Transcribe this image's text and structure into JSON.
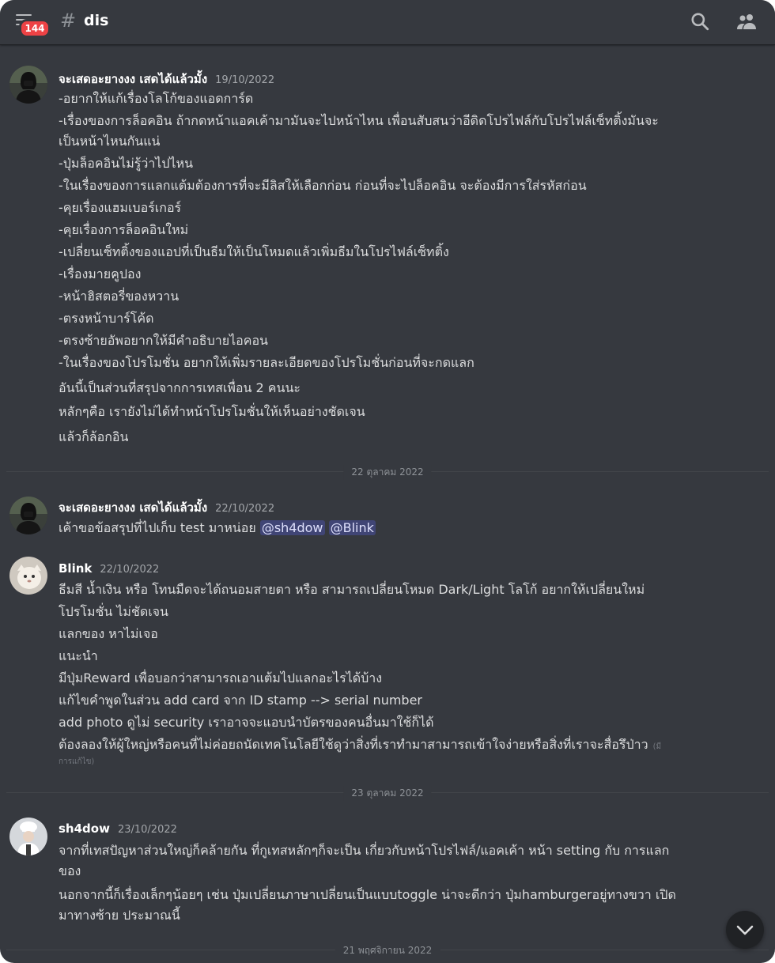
{
  "header": {
    "badge_count": "144",
    "hash": "#",
    "channel": "dis"
  },
  "messages": [
    {
      "author": "จะเสดอะยางงง เสดได้แล้วมั้ง",
      "timestamp": "19/10/2022",
      "lines": [
        "-อยากให้แก้เรื่องโลโก้ของแอดการ์ด",
        "-เรื่องของการล็อคอิน ถ้ากดหน้าแอคเค้ามามันจะไปหน้าไหน เพื่อนสับสนว่าอีดิดโปรไฟล์กับโปรไฟล์เซ็ทติ้งมันจะ",
        "เป็นหน้าไหนกันแน่",
        "-ปุ่มล็อคอินไม่รู้ว่าไปไหน",
        "-ในเรื่องของการแลกแต้มต้องการที่จะมีลิสให้เลือกก่อน ก่อนที่จะไปล็อคอิน จะต้องมีการใส่รหัสก่อน",
        "-คุยเรื่องแฮมเบอร์เกอร์",
        "-คุยเรื่องการล็อคอินใหม่",
        "-เปลี่ยนเซ็ทติ้งของแอปที่เป็นธีมให้เป็นโหมดแล้วเพิ่มธีมในโปรไฟล์เซ็ทติ้ง",
        "-เรื่องมายคูปอง",
        "-หน้าฮิสตอรี่ของหวาน",
        "-ตรงหน้าบาร์โค้ด",
        "-ตรงซ้ายอัพอยากให้มีคำอธิบายไอคอน",
        "-ในเรื่องของโปรโมชั่น อยากให้เพิ่มรายละเอียดของโปรโมชั่นก่อนที่จะกดแลก"
      ],
      "extra_lines": [
        "อันนี้เป็นส่วนที่สรุปจากการเทสเพื่อน 2 คนนะ",
        "หลักๆคือ เรายังไม่ได้ทำหน้าโปรโมชั่นให้เห็นอย่างชัดเจน",
        "แล้วก็ล้อกอิน"
      ]
    },
    {
      "author": "จะเสดอะยางงง เสดได้แล้วมั้ง",
      "timestamp": "22/10/2022",
      "text": "เค้าขอข้อสรุปที่ไปเก็บ test มาหน่อย",
      "mentions": [
        "@sh4dow",
        "@Blink"
      ]
    },
    {
      "author": "Blink",
      "timestamp": "22/10/2022",
      "lines": [
        "ธีมสี น้ำเงิน หรือ โทนมืดจะได้ถนอมสายตา หรือ สามารถเปลี่ยนโหมด Dark/Light โลโก้ อยากให้เปลี่ยนใหม่",
        "โปรโมชั่น ไม่ชัดเจน",
        "แลกของ หาไม่เจอ",
        "แนะนำ",
        " มีปุ่มReward เพื่อบอกว่าสามารถเอาแต้มไปแลกอะไรได้บ้าง",
        "แก้ไขคำพูดในส่วน add card จาก ID stamp --> serial number",
        "add photo ดูไม่ security เราอาจจะแอบนำบัตรของคนอื่นมาใช้ก็ได้",
        "ต้องลองให้ผู้ใหญ่หรือคนที่ไม่ค่อยถนัดเทคโนโลยีใช้ดูว่าสิ่งที่เราทำมาสามารถเข้าใจง่ายหรือสิ่งที่เราจะสื่อรึป่าว"
      ],
      "edited_a": "(มี",
      "edited_b": "การแก้ไข)"
    },
    {
      "author": "sh4dow",
      "timestamp": "23/10/2022",
      "lines": [
        "จากที่เทสปัญหาส่วนใหญ่ก็คล้ายกัน ที่กูเทสหลักๆก็จะเป็น เกี่ยวกับหน้าโปรไฟล์/แอคเค้า หน้า setting กับ การแลก",
        "ของ",
        "นอกจากนี้ก็เรื่องเล็กๆน้อยๆ เช่น ปุ่มเปลี่ยนภาษาเปลี่ยนเป็นแบบtoggle น่าจะดีกว่า ปุ่มhamburgerอยู่ทางขวา เปิด",
        "มาทางซ้าย ประมาณนี้"
      ]
    }
  ],
  "dividers": [
    "22 ตุลาคม 2022",
    "23 ตุลาคม 2022",
    "21 พฤศจิกายน 2022"
  ],
  "icons": {
    "menu": "hamburger-menu-icon",
    "search": "search-icon",
    "members": "members-icon",
    "scroll": "chevron-down-icon"
  },
  "colors": {
    "background": "#36393f",
    "badge": "#ed4245",
    "mention": "#5865f2"
  }
}
